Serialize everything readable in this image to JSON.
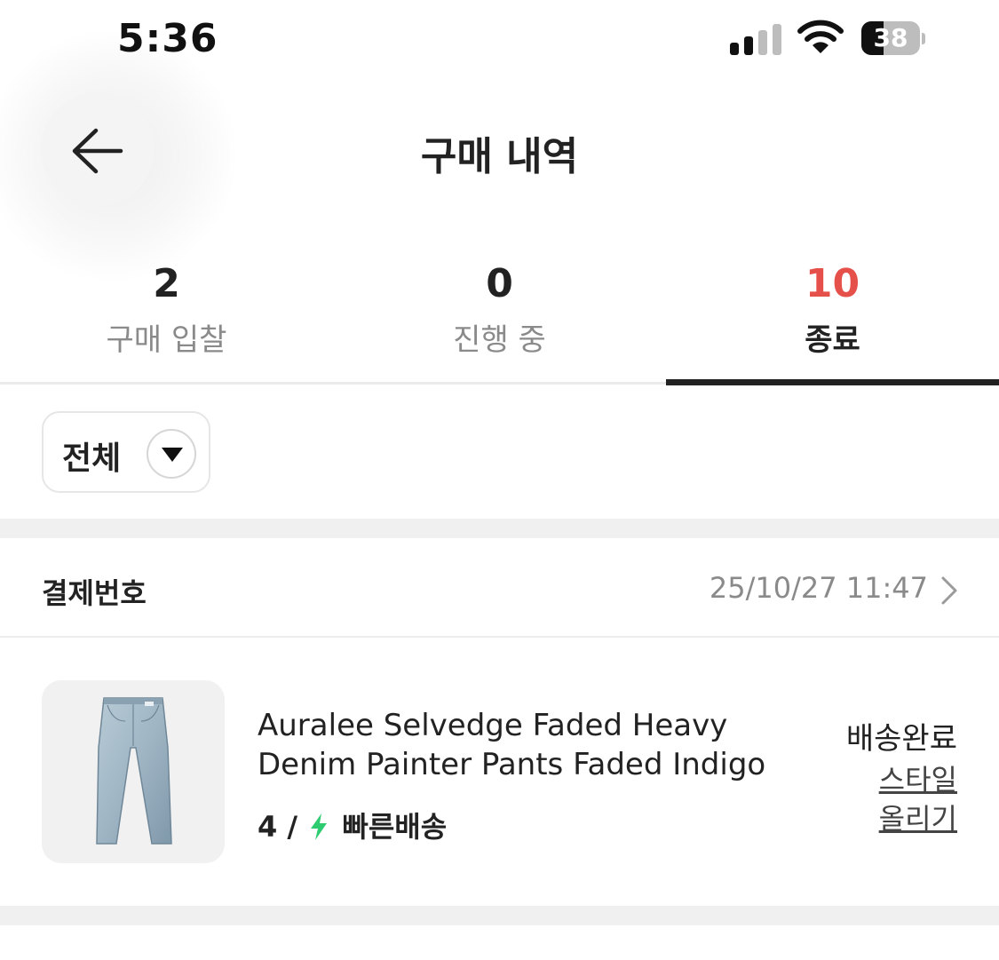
{
  "status_bar": {
    "time": "5:36",
    "battery": "38",
    "battery_level": 0.38,
    "icons": [
      "signal-icon",
      "wifi-icon",
      "battery-icon"
    ]
  },
  "header": {
    "title": "구매 내역",
    "back_icon": "arrow-left-icon"
  },
  "tabs": [
    {
      "count": "2",
      "label": "구매 입찰",
      "active": false
    },
    {
      "count": "0",
      "label": "진행 중",
      "active": false
    },
    {
      "count": "10",
      "label": "종료",
      "active": true
    }
  ],
  "filter": {
    "label": "전체",
    "icon": "caret-down-icon"
  },
  "order": {
    "label": "결제번호",
    "date": "25/10/27 11:47",
    "chevron_icon": "chevron-right-icon"
  },
  "product": {
    "image_icon": "jeans-icon",
    "name": "Auralee Selvedge Faded Heavy Denim Painter Pants Faded Indigo",
    "size": "4 /",
    "delivery_icon": "lightning-icon",
    "delivery": "빠른배송",
    "status": "배송완료",
    "style_link": "스타일 올리기"
  },
  "colors": {
    "accent": "#e5504a",
    "fast_delivery": "#2ecc71",
    "text": "#222222",
    "muted": "#8a8a8a"
  }
}
